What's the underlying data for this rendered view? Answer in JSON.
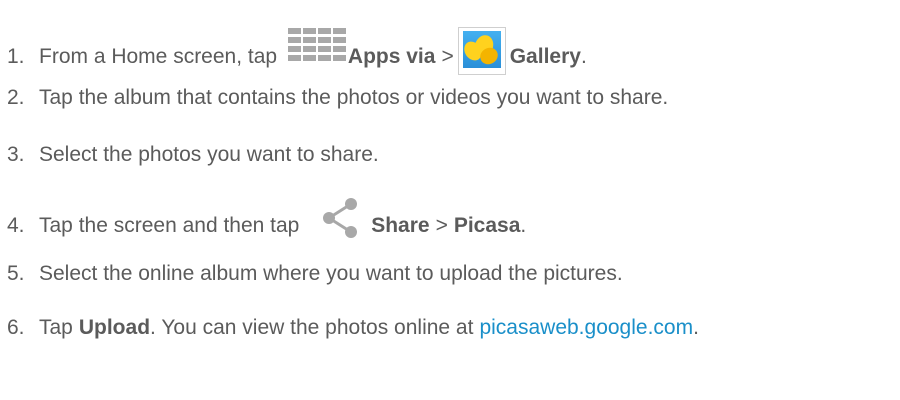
{
  "steps": [
    {
      "number": "1.",
      "text_a": "From a Home screen, tap",
      "icon_a": "apps-grid-icon",
      "bold_a": "Apps via",
      "sep": ">",
      "icon_b": "gallery-icon",
      "bold_b": "Gallery",
      "end": "."
    },
    {
      "number": "2.",
      "text": "Tap the album that contains the photos or videos you want to share."
    },
    {
      "number": "3.",
      "text": "Select the photos you want to share."
    },
    {
      "number": "4.",
      "text_a": "Tap the screen and then tap",
      "icon_a": "share-icon",
      "bold_a": "Share",
      "sep": ">",
      "bold_b": "Picasa",
      "end": "."
    },
    {
      "number": "5.",
      "text": "Select the online album where you want to upload the pictures."
    },
    {
      "number": "6.",
      "text_a": "Tap",
      "bold_a": "Upload",
      "text_b": ". You can view the photos online at",
      "link": "picasaweb.google.com",
      "end": "."
    }
  ],
  "colors": {
    "text": "#5b5b5b",
    "link": "#1a8fc9",
    "icon_gray": "#a8a8a8",
    "gallery_sky": "#2a8fd8",
    "gallery_flower": "#ffd21e"
  }
}
